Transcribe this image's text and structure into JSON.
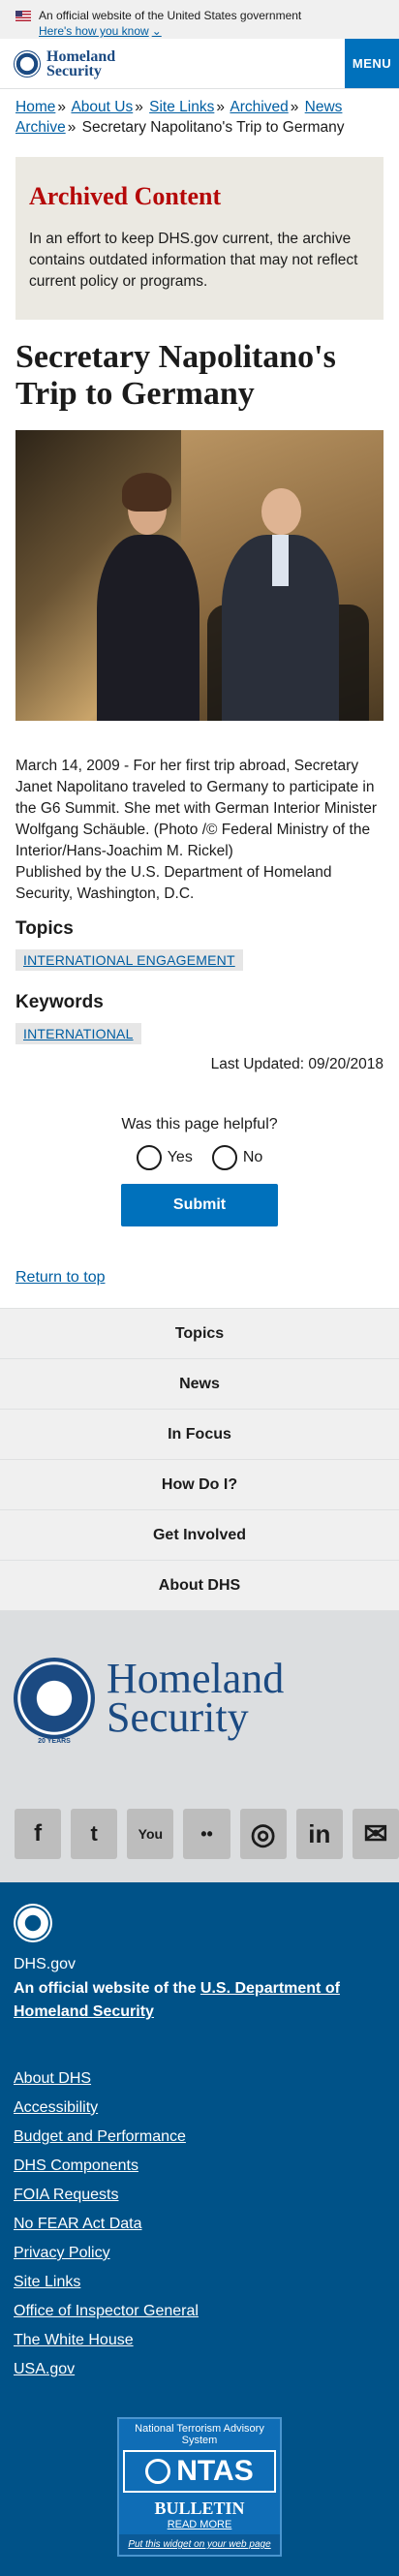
{
  "banner": {
    "official_text": "An official website of the United States government",
    "how_label": "Here's how you know"
  },
  "header": {
    "logo_line1": "Homeland",
    "logo_line2": "Security",
    "menu_label": "MENU"
  },
  "breadcrumb": {
    "items": [
      "Home",
      "About Us",
      "Site Links",
      "Archived",
      "News Archive"
    ],
    "current": "Secretary Napolitano's Trip to Germany"
  },
  "archived": {
    "title": "Archived Content",
    "text": "In an effort to keep DHS.gov current, the archive contains outdated information that may not reflect current policy or programs."
  },
  "article": {
    "title": "Secretary Napolitano's Trip to Germany",
    "caption": "March 14, 2009 - For her first trip abroad, Secretary Janet Napolitano traveled to Germany to participate in the G6 Summit. She met with German Interior Minister Wolfgang Schäuble. (Photo /© Federal Ministry of the Interior/Hans-Joachim M. Rickel)",
    "published": "Published by the U.S. Department of Homeland Security, Washington, D.C."
  },
  "topics": {
    "heading": "Topics",
    "tag": "INTERNATIONAL ENGAGEMENT"
  },
  "keywords": {
    "heading": "Keywords",
    "tag": "INTERNATIONAL"
  },
  "last_updated": "Last Updated: 09/20/2018",
  "feedback": {
    "question": "Was this page helpful?",
    "yes": "Yes",
    "no": "No",
    "submit": "Submit"
  },
  "return_top": "Return to top",
  "footer_nav": [
    "Topics",
    "News",
    "In Focus",
    "How Do I?",
    "Get Involved",
    "About DHS"
  ],
  "footer_logo": {
    "line1": "Homeland",
    "line2": "Security",
    "years": "20 YEARS"
  },
  "social": [
    "f",
    "t",
    "You",
    "••",
    "◎",
    "in",
    "✉"
  ],
  "dark_footer": {
    "domain": "DHS.gov",
    "official_prefix": "An official website of the ",
    "official_link": "U.S. Department of Homeland Security",
    "links": [
      "About DHS",
      "Accessibility",
      "Budget and Performance",
      "DHS Components",
      "FOIA Requests",
      "No FEAR Act Data",
      "Privacy Policy",
      "Site Links",
      "Office of Inspector General",
      "The White House",
      "USA.gov"
    ]
  },
  "ntas": {
    "line1": "National Terrorism Advisory System",
    "logo": "NTAS",
    "bulletin": "BULLETIN",
    "read_more": "READ MORE",
    "widget": "Put this widget on your web page"
  }
}
